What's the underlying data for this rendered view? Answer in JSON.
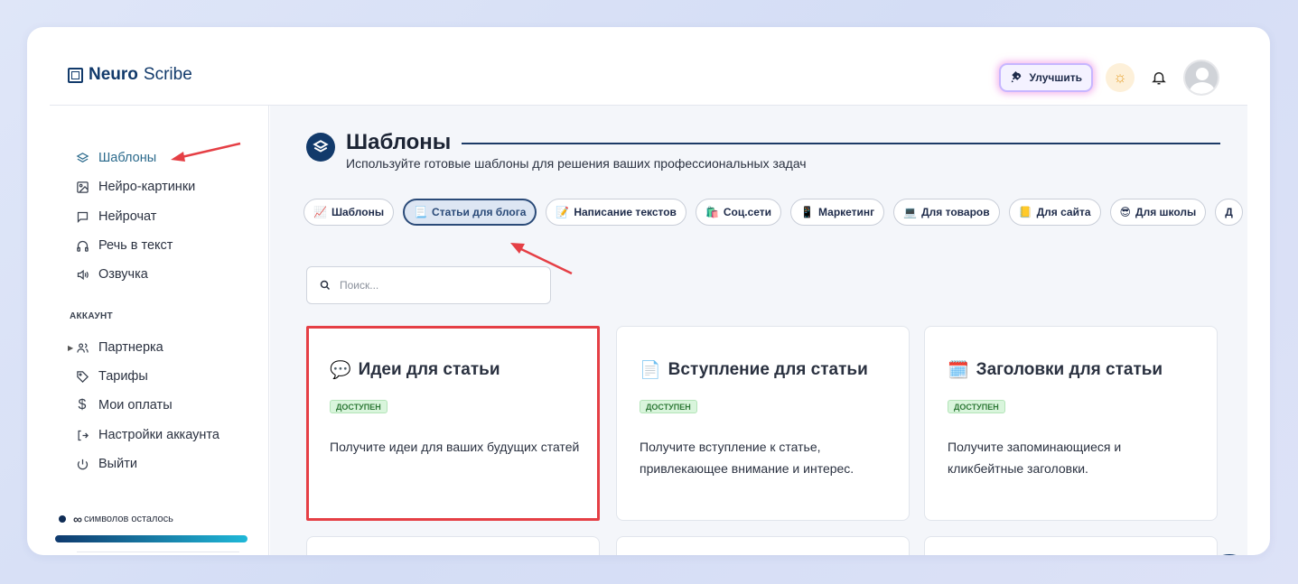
{
  "app": {
    "logo_bold": "Neuro",
    "logo_thin": "Scribe"
  },
  "header": {
    "upgrade_label": "Улучшить"
  },
  "sidebar": {
    "items": [
      {
        "label": "Шаблоны",
        "icon": "layers-icon"
      },
      {
        "label": "Нейро-картинки",
        "icon": "image-icon"
      },
      {
        "label": "Нейрочат",
        "icon": "chat-icon"
      },
      {
        "label": "Речь в текст",
        "icon": "headphones-icon"
      },
      {
        "label": "Озвучка",
        "icon": "speaker-icon"
      }
    ],
    "account_label": "АККАУНТ",
    "account_items": [
      {
        "label": "Партнерка",
        "icon": "users-icon"
      },
      {
        "label": "Тарифы",
        "icon": "tag-icon"
      },
      {
        "label": "Мои оплаты",
        "icon": "dollar-icon"
      },
      {
        "label": "Настройки аккаунта",
        "icon": "logout-arrow-icon"
      },
      {
        "label": "Выйти",
        "icon": "power-icon"
      }
    ],
    "credits_symbol": "∞",
    "credits_text": "символов осталось"
  },
  "main": {
    "title": "Шаблоны",
    "subtitle": "Используйте готовые шаблоны для решения ваших профессиональных задач",
    "chips": [
      {
        "emoji": "📈",
        "label": "Шаблоны"
      },
      {
        "emoji": "📃",
        "label": "Статьи для блога"
      },
      {
        "emoji": "📝",
        "label": "Написание текстов"
      },
      {
        "emoji": "🛍️",
        "label": "Соц.сети"
      },
      {
        "emoji": "📱",
        "label": "Маркетинг"
      },
      {
        "emoji": "💻",
        "label": "Для товаров"
      },
      {
        "emoji": "📒",
        "label": "Для сайта"
      },
      {
        "emoji": "😎",
        "label": "Для школы"
      },
      {
        "emoji": "",
        "label": "Д"
      }
    ],
    "search_placeholder": "Поиск...",
    "cards": [
      {
        "emoji": "💬",
        "title": "Идеи для статьи",
        "badge": "ДОСТУПЕН",
        "desc": "Получите идеи для ваших будущих статей"
      },
      {
        "emoji": "📄",
        "title": "Вступление для статьи",
        "badge": "ДОСТУПЕН",
        "desc": "Получите вступление к статье, привлекающее внимание и интерес."
      },
      {
        "emoji": "🗓️",
        "title": "Заголовки для статьи",
        "badge": "ДОСТУПЕН",
        "desc": "Получите запоминающиеся и кликбейтные заголовки."
      }
    ]
  },
  "colors": {
    "brand": "#123a6b",
    "active_nav": "#2b6a8c",
    "highlight": "#e53f45",
    "badge_bg": "#d9f5dc"
  }
}
